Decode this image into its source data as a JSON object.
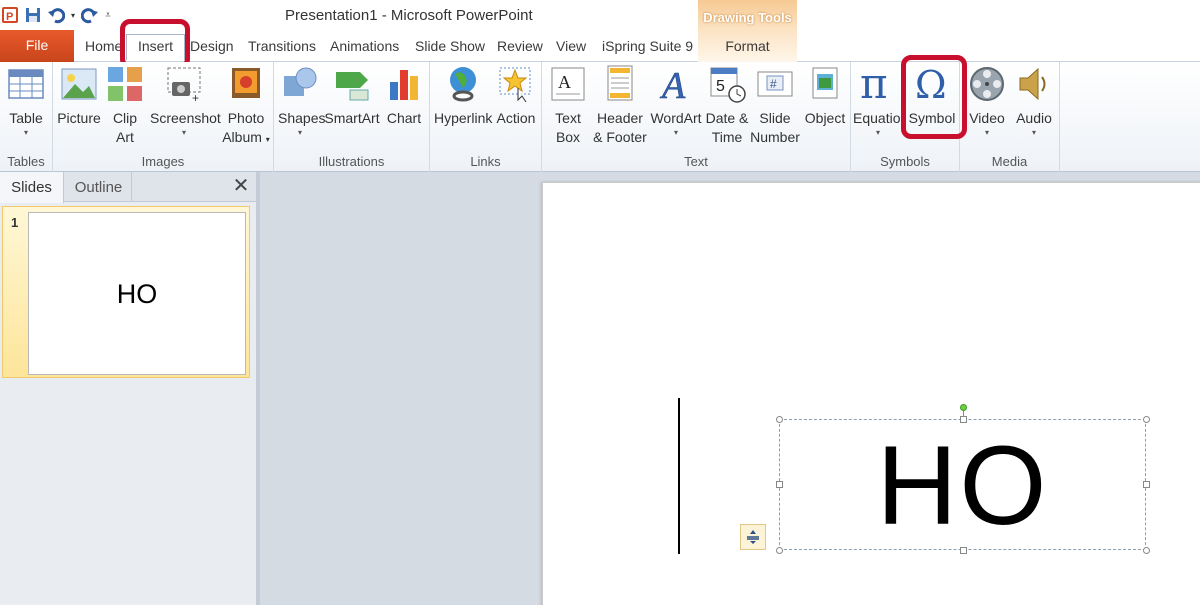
{
  "window": {
    "title": "Presentation1  -  Microsoft PowerPoint",
    "context_tab_group": "Drawing Tools"
  },
  "tabs": {
    "file": "File",
    "home": "Home",
    "insert": "Insert",
    "design": "Design",
    "transitions": "Transitions",
    "animations": "Animations",
    "slide_show": "Slide Show",
    "review": "Review",
    "view": "View",
    "ispring": "iSpring Suite 9",
    "format": "Format"
  },
  "ribbon": {
    "groups": {
      "tables": "Tables",
      "images": "Images",
      "illustrations": "Illustrations",
      "links": "Links",
      "text": "Text",
      "symbols": "Symbols",
      "media": "Media"
    },
    "buttons": {
      "table": "Table",
      "picture": "Picture",
      "clip_art_1": "Clip",
      "clip_art_2": "Art",
      "screenshot": "Screenshot",
      "photo_album_1": "Photo",
      "photo_album_2": "Album",
      "shapes": "Shapes",
      "smartart": "SmartArt",
      "chart": "Chart",
      "hyperlink": "Hyperlink",
      "action": "Action",
      "text_box_1": "Text",
      "text_box_2": "Box",
      "header_footer_1": "Header",
      "header_footer_2": "& Footer",
      "wordart": "WordArt",
      "date_time_1": "Date &",
      "date_time_2": "Time",
      "slide_number_1": "Slide",
      "slide_number_2": "Number",
      "object": "Object",
      "equation": "Equation",
      "symbol": "Symbol",
      "video": "Video",
      "audio": "Audio"
    }
  },
  "slides_panel": {
    "tab_slides": "Slides",
    "tab_outline": "Outline",
    "close_glyph": "✕",
    "thumbnails": [
      {
        "number": "1",
        "text": "HO"
      }
    ]
  },
  "slide": {
    "text": "HO"
  },
  "colors": {
    "file_tab": "#d04a1f",
    "highlight_ring": "#c8102e",
    "context_tab": "#f6c992"
  }
}
